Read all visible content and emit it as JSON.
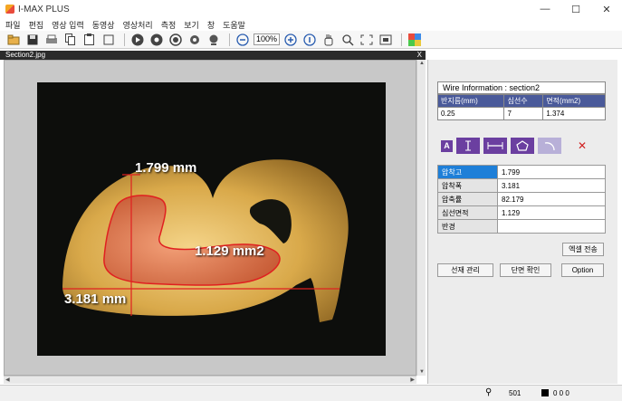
{
  "app": {
    "title": "I-MAX PLUS"
  },
  "window_controls": {
    "minimize": "—",
    "maximize": "☐",
    "close": "✕"
  },
  "menu": [
    "파일",
    "편집",
    "영상 입력",
    "동영상",
    "영상처리",
    "측정",
    "보기",
    "창",
    "도움말"
  ],
  "toolbar": {
    "zoom": "100%"
  },
  "document": {
    "tab_title": "Section2.jpg",
    "close": "X"
  },
  "measurements_overlay": {
    "height_label": "1.799 mm",
    "area_label": "1.129 mm2",
    "width_label": "3.181 mm"
  },
  "wire_info": {
    "title": "Wire Information : section2",
    "headers": [
      "반지름(mm)",
      "심선수",
      "면적(mm2)"
    ],
    "values": [
      "0.25",
      "7",
      "1.374"
    ]
  },
  "tools": {
    "a_label": "A"
  },
  "results": [
    {
      "label": "압착고",
      "value": "1.799",
      "selected": true
    },
    {
      "label": "압착폭",
      "value": "3.181",
      "selected": false
    },
    {
      "label": "압축률",
      "value": "82.179",
      "selected": false
    },
    {
      "label": "심선면적",
      "value": "1.129",
      "selected": false
    },
    {
      "label": "반경",
      "value": "",
      "selected": false
    }
  ],
  "buttons": {
    "excel": "엑셀 전송",
    "wire_manage": "선재 관리",
    "section_confirm": "단면 확인",
    "option": "Option"
  },
  "status": {
    "value1": "501",
    "value2": "0 0 0"
  },
  "colors": {
    "accent_purple": "#6b3fa0",
    "header_blue": "#4a5a9a",
    "selected_blue": "#1e7fd8",
    "measure_red": "#e02020"
  }
}
